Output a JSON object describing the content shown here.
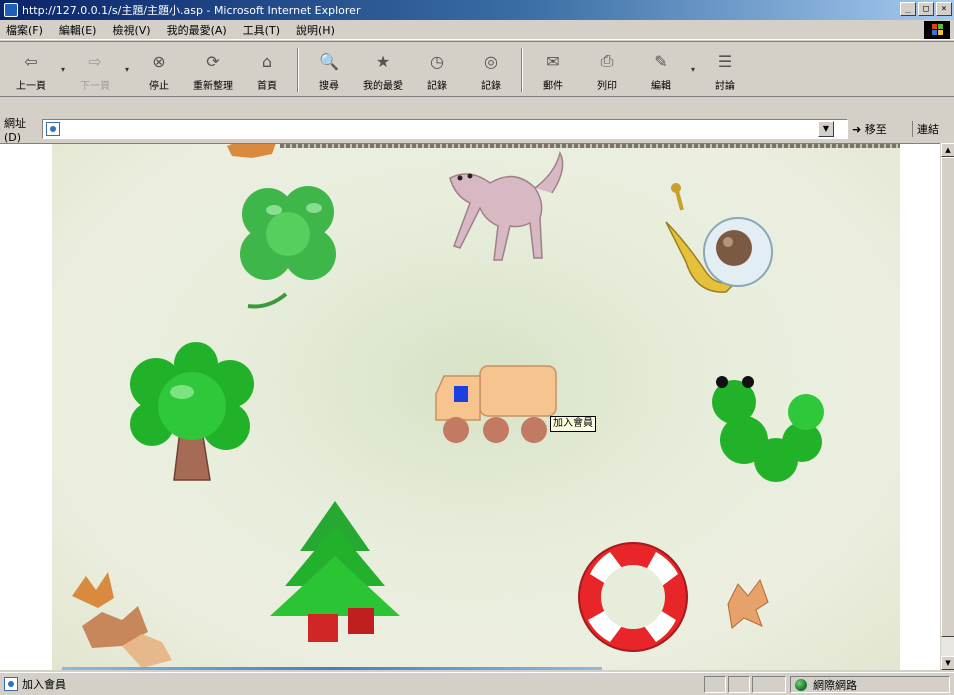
{
  "window": {
    "title": "http://127.0.0.1/s/主題/主題小.asp - Microsoft Internet Explorer",
    "controls": {
      "minimize": "_",
      "maximize": "□",
      "close": "×"
    }
  },
  "menubar": {
    "items": [
      "檔案(F)",
      "編輯(E)",
      "檢視(V)",
      "我的最愛(A)",
      "工具(T)",
      "說明(H)"
    ]
  },
  "toolbar": {
    "buttons": [
      {
        "label": "上一頁",
        "icon": "back-arrow-icon",
        "glyph": "⇦"
      },
      {
        "label": "下一頁",
        "icon": "forward-arrow-icon",
        "glyph": "⇨"
      },
      {
        "label": "停止",
        "icon": "stop-icon",
        "glyph": "⊗"
      },
      {
        "label": "重新整理",
        "icon": "refresh-icon",
        "glyph": "⟳"
      },
      {
        "label": "首頁",
        "icon": "home-icon",
        "glyph": "⌂"
      },
      {
        "label": "搜尋",
        "icon": "search-icon",
        "glyph": "🔍"
      },
      {
        "label": "我的最愛",
        "icon": "favorites-icon",
        "glyph": "★"
      },
      {
        "label": "記錄",
        "icon": "history-icon",
        "glyph": "◷"
      },
      {
        "label": "記錄",
        "icon": "channels-icon",
        "glyph": "◎"
      },
      {
        "label": "郵件",
        "icon": "mail-icon",
        "glyph": "✉"
      },
      {
        "label": "列印",
        "icon": "print-icon",
        "glyph": "⎙"
      },
      {
        "label": "編輯",
        "icon": "edit-icon",
        "glyph": "✎"
      },
      {
        "label": "討論",
        "icon": "discuss-icon",
        "glyph": "☰"
      }
    ]
  },
  "addressbar": {
    "label": "網址(D)",
    "value": "",
    "go_label": "移至",
    "links_label": "連結"
  },
  "page": {
    "tooltip": "加入會員"
  },
  "statusbar": {
    "text": "加入會員",
    "zone": "網際網路"
  },
  "colors": {
    "title_gradient_start": "#0a246a",
    "title_gradient_end": "#a6caf0",
    "chrome": "#d4d0c8",
    "tooltip_bg": "#ffffe1"
  }
}
